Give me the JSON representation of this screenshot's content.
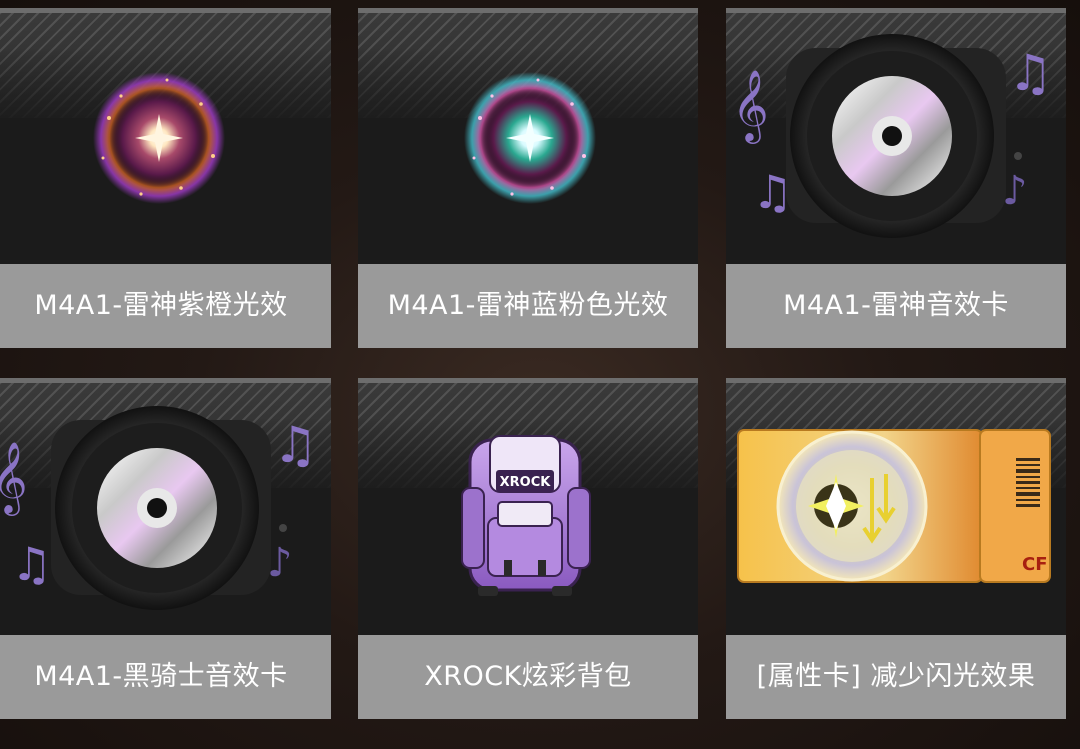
{
  "items": [
    {
      "name": "M4A1-雷神紫橙光效",
      "icon": "purple-orange-glow-effect-icon"
    },
    {
      "name": "M4A1-雷神蓝粉色光效",
      "icon": "blue-pink-glow-effect-icon"
    },
    {
      "name": "M4A1-雷神音效卡",
      "icon": "sound-card-disc-icon"
    },
    {
      "name": "M4A1-黑骑士音效卡",
      "icon": "sound-card-disc-icon"
    },
    {
      "name": "XROCK炫彩背包",
      "icon": "backpack-icon"
    },
    {
      "name": "[属性卡] 减少闪光效果",
      "icon": "attribute-card-flash-icon"
    }
  ],
  "art_text": {
    "backpack_logo": "XROCK",
    "card_brand": "CF"
  },
  "colors": {
    "label_bg": "#9a9a9a",
    "card_bg": "#1b1b1b",
    "label_text": "#ffffff"
  }
}
